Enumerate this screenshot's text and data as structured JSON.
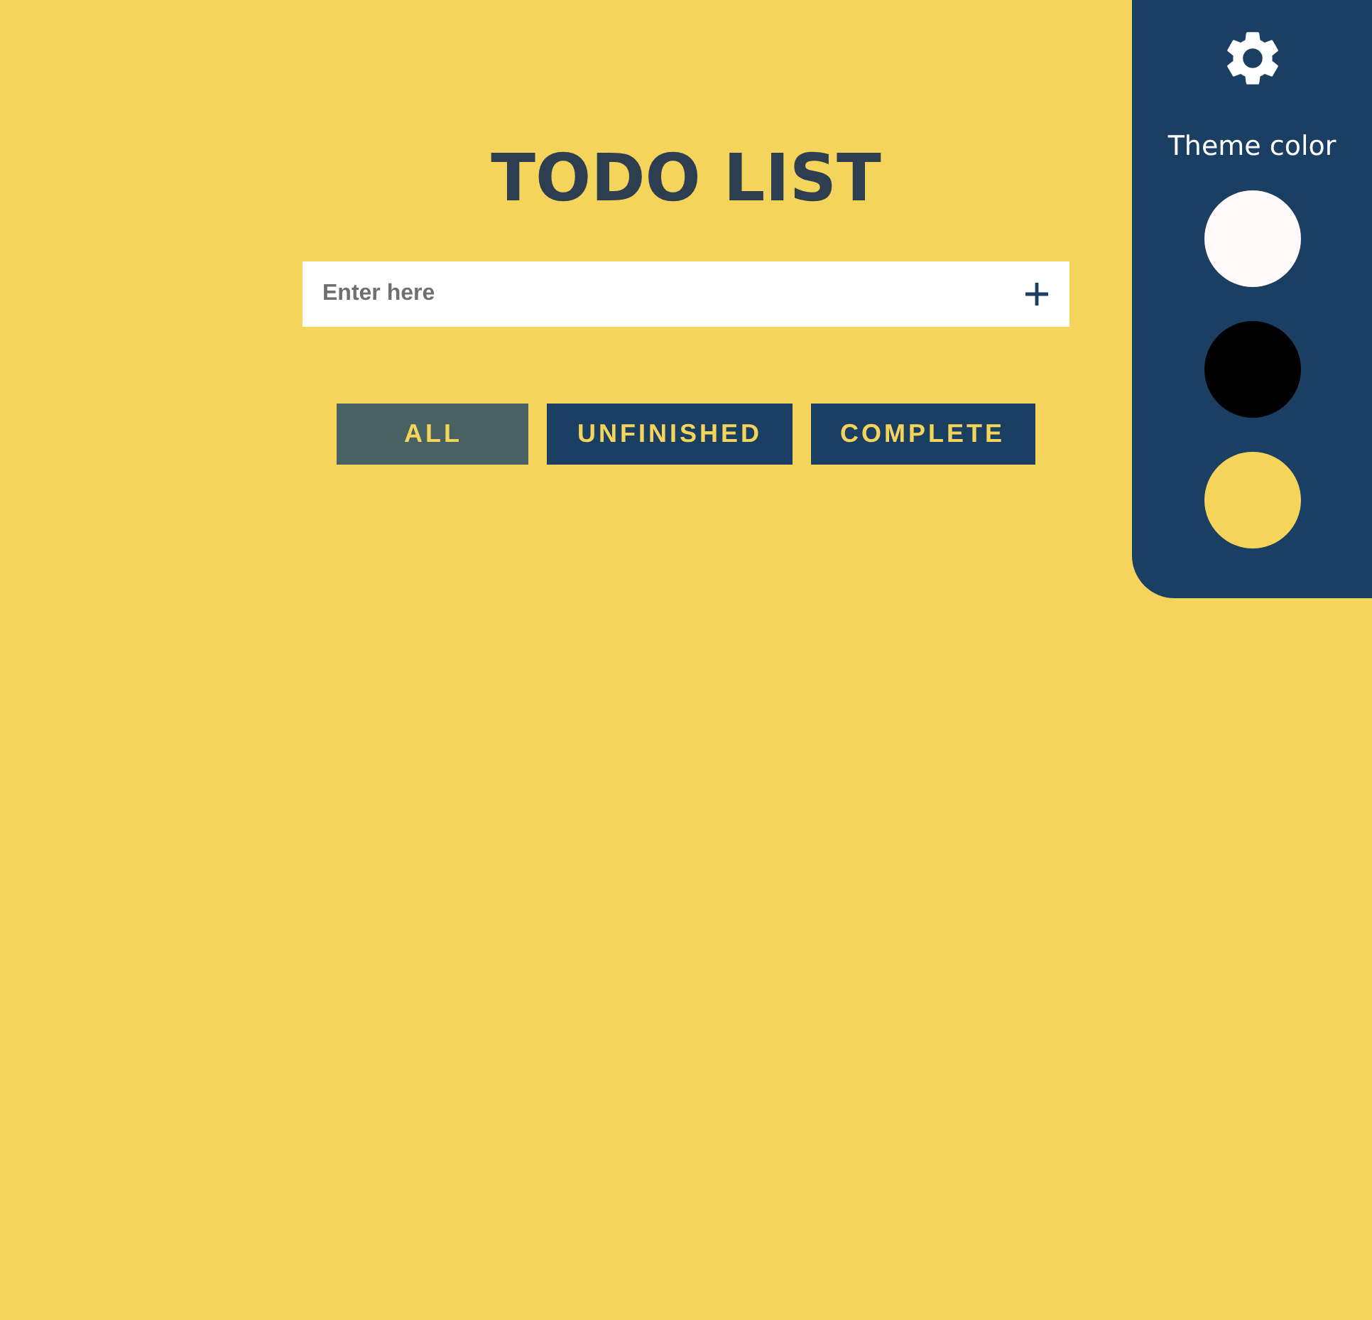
{
  "title": "TODO LIST",
  "input": {
    "placeholder": "Enter here"
  },
  "filters": [
    {
      "label": "ALL",
      "selected": true
    },
    {
      "label": "UNFINISHED",
      "selected": false
    },
    {
      "label": "COMPLETE",
      "selected": false
    }
  ],
  "theme_panel": {
    "label": "Theme color",
    "swatches": [
      {
        "color": "#fff9f9"
      },
      {
        "color": "#000000"
      },
      {
        "color": "#f5d45c"
      }
    ]
  }
}
